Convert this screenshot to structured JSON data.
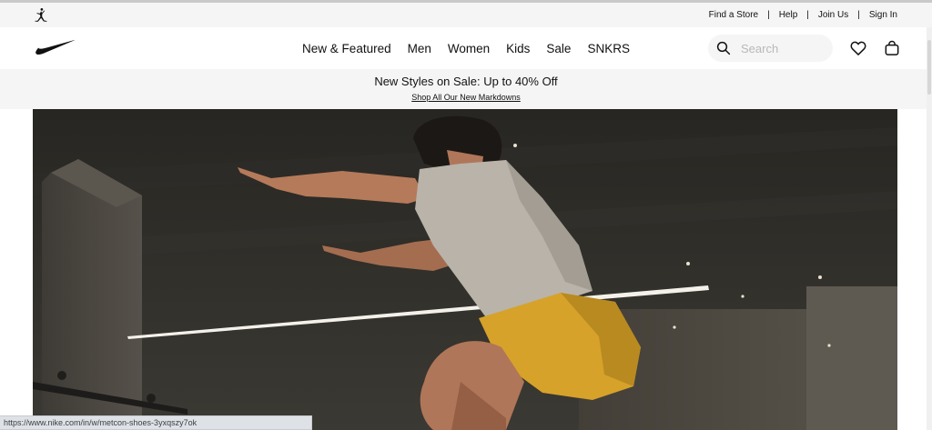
{
  "utility_bar": {
    "links": [
      "Find a Store",
      "Help",
      "Join Us",
      "Sign In"
    ],
    "logo_icon": "jordan-jumpman-icon"
  },
  "header": {
    "logo_icon": "nike-swoosh-icon",
    "nav": [
      "New & Featured",
      "Men",
      "Women",
      "Kids",
      "Sale",
      "SNKRS"
    ],
    "search": {
      "placeholder": "Search",
      "value": ""
    },
    "favorites_icon": "heart-icon",
    "bag_icon": "bag-icon"
  },
  "promo": {
    "title": "New Styles on Sale: Up to 40% Off",
    "link": "Shop All Our New Markdowns"
  },
  "hero": {
    "image": "athlete-jumping-photo",
    "colors": {
      "shirt": "#b9b3a9",
      "shorts": "#d6a22a",
      "background": "#2f2e2a"
    }
  },
  "status_bar": {
    "url": "https://www.nike.com/in/w/metcon-shoes-3yxqszy7ok"
  }
}
